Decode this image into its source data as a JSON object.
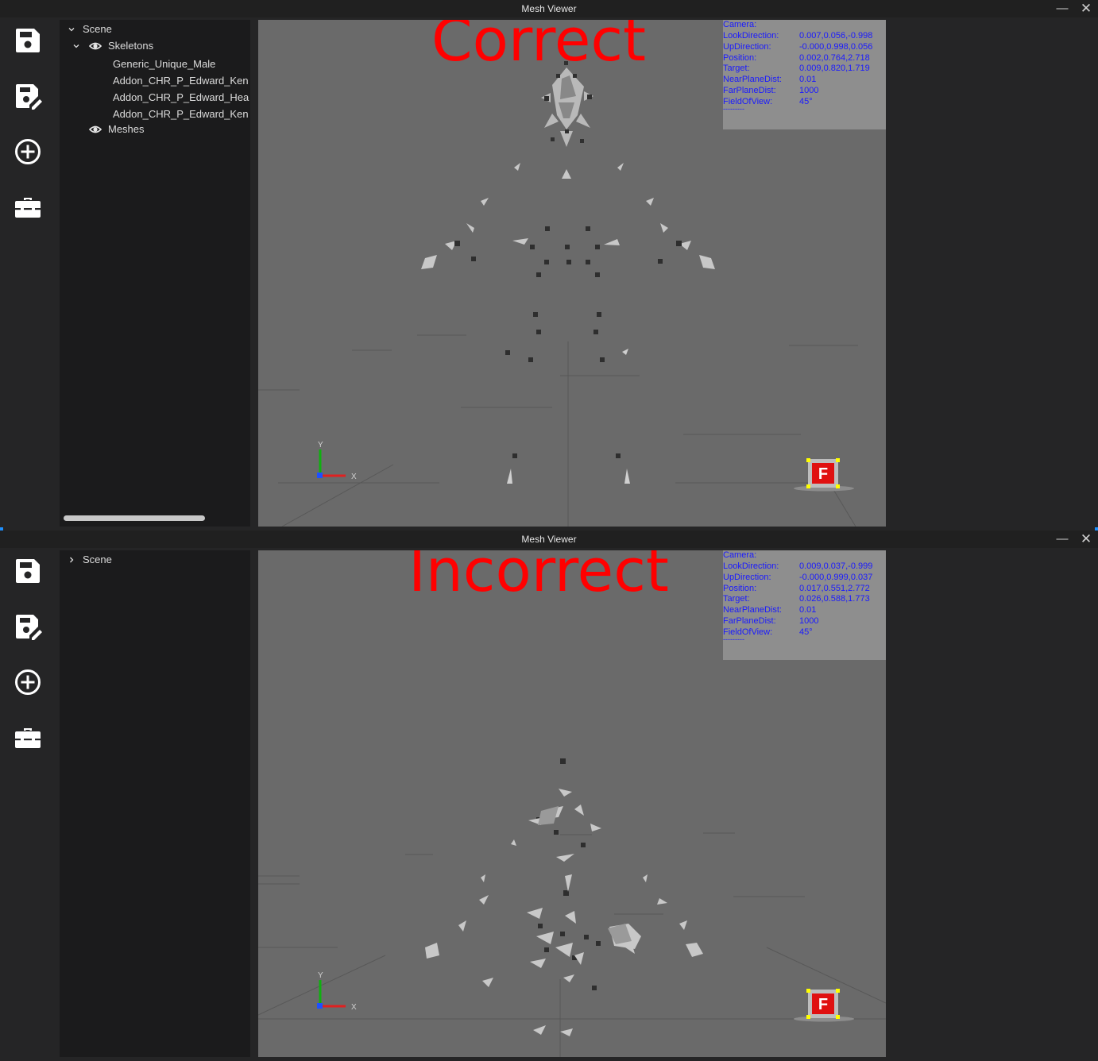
{
  "colors": {
    "bg": "#252526",
    "tree_bg": "#1b1b1c",
    "viewport_bg": "#6a6a6a",
    "overlay_bg": "#8e8e8e",
    "camera_text": "#1a1aff",
    "annotation": "#ff0000",
    "axis_x": "#e02020",
    "axis_y": "#10b010",
    "axis_z": "#1e50ff"
  },
  "windows": [
    {
      "title": "Mesh Viewer",
      "controls": {
        "minimize_icon": "—",
        "close_icon": "✕"
      },
      "toolbar": [
        {
          "icon": "save-icon"
        },
        {
          "icon": "save-edit-icon"
        },
        {
          "icon": "add-circle-icon"
        },
        {
          "icon": "toolbox-icon"
        }
      ],
      "tree": {
        "root": {
          "label": "Scene",
          "expanded": true
        },
        "skeletons": {
          "label": "Skeletons",
          "expanded": true,
          "visible_icon": "eye-icon"
        },
        "skeleton_items": [
          "Generic_Unique_Male",
          "Addon_CHR_P_Edward_Ken",
          "Addon_CHR_P_Edward_Hea",
          "Addon_CHR_P_Edward_Ken"
        ],
        "meshes": {
          "label": "Meshes",
          "visible_icon": "eye-icon"
        }
      },
      "viewport": {
        "annotation": "Correct",
        "camera": {
          "header": "Camera:",
          "rows": [
            {
              "key": "LookDirection:",
              "value": "0.007,0.056,-0.998"
            },
            {
              "key": "UpDirection:",
              "value": "-0.000,0.998,0.056"
            },
            {
              "key": "Position:",
              "value": "0.002,0.764,2.718"
            },
            {
              "key": "Target:",
              "value": "0.009,0.820,1.719"
            },
            {
              "key": "NearPlaneDist:",
              "value": "0.01"
            },
            {
              "key": "FarPlaneDist:",
              "value": "1000"
            },
            {
              "key": "FieldOfView:",
              "value": "45°"
            }
          ],
          "footer": "---------"
        },
        "axes": {
          "y": "Y",
          "x": "X"
        },
        "view_cube_label": "F"
      }
    },
    {
      "title": "Mesh Viewer",
      "controls": {
        "minimize_icon": "—",
        "close_icon": "✕"
      },
      "toolbar": [
        {
          "icon": "save-icon"
        },
        {
          "icon": "save-edit-icon"
        },
        {
          "icon": "add-circle-icon"
        },
        {
          "icon": "toolbox-icon"
        }
      ],
      "tree": {
        "root": {
          "label": "Scene",
          "expanded": false
        }
      },
      "viewport": {
        "annotation": "Incorrect",
        "camera": {
          "header": "Camera:",
          "rows": [
            {
              "key": "LookDirection:",
              "value": "0.009,0.037,-0.999"
            },
            {
              "key": "UpDirection:",
              "value": "-0.000,0.999,0.037"
            },
            {
              "key": "Position:",
              "value": "0.017,0.551,2.772"
            },
            {
              "key": "Target:",
              "value": "0.026,0.588,1.773"
            },
            {
              "key": "NearPlaneDist:",
              "value": "0.01"
            },
            {
              "key": "FarPlaneDist:",
              "value": "1000"
            },
            {
              "key": "FieldOfView:",
              "value": "45°"
            }
          ],
          "footer": "---------"
        },
        "axes": {
          "y": "Y",
          "x": "X"
        },
        "view_cube_label": "F"
      }
    }
  ]
}
